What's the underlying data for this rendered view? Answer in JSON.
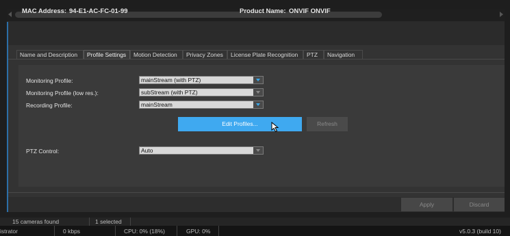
{
  "header": {
    "mac_label": "MAC Address:",
    "mac_value": "94-E1-AC-FC-01-99",
    "product_label": "Product Name:",
    "product_value": "ONVIF ONVIF"
  },
  "tabs": [
    {
      "label": "Name and Description",
      "active": false
    },
    {
      "label": "Profile Settings",
      "active": true
    },
    {
      "label": "Motion Detection",
      "active": false
    },
    {
      "label": "Privacy Zones",
      "active": false
    },
    {
      "label": "License Plate Recognition",
      "active": false
    },
    {
      "label": "PTZ",
      "active": false
    },
    {
      "label": "Navigation",
      "active": false
    }
  ],
  "profile": {
    "monitoring_label": "Monitoring Profile:",
    "monitoring_value": "mainStream (with PTZ)",
    "monitoring_low_label": "Monitoring Profile (low res.):",
    "monitoring_low_value": "subStream (with PTZ)",
    "recording_label": "Recording Profile:",
    "recording_value": "mainStream",
    "edit_profiles_label": "Edit Profiles...",
    "refresh_label": "Refresh",
    "ptz_label": "PTZ Control:",
    "ptz_value": "Auto"
  },
  "footer": {
    "apply_label": "Apply",
    "discard_label": "Discard"
  },
  "status": {
    "cameras_found": "15 cameras found",
    "selected": "1 selected",
    "user": "istrator",
    "bandwidth": "0 kbps",
    "cpu": "CPU: 0% (18%)",
    "gpu": "GPU: 0%",
    "version": "v5.0.3 (build 10)"
  },
  "colors": {
    "accent": "#3fa9f0",
    "panel": "#333333",
    "content": "#3a3a3a"
  }
}
